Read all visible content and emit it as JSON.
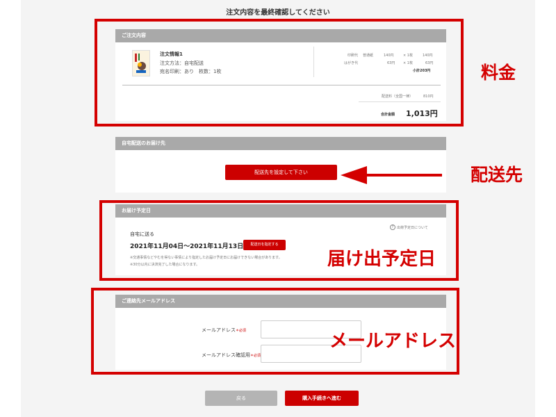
{
  "page_title": "注文内容を最終確認してください",
  "order_panel": {
    "header": "ご注文内容",
    "product_name": "注文情報1",
    "shipping_method": "注文方法：自宅配送",
    "print_option": "宛名印刷：あり　枚数：1枚",
    "price_rows": [
      {
        "label": "印刷代",
        "item": "普通紙",
        "unit": "140円",
        "qty": "× 1枚",
        "amount": "140円"
      },
      {
        "label": "はがき代",
        "item": "",
        "unit": "63円",
        "qty": "× 1枚",
        "amount": "63円"
      }
    ],
    "subtotal": "小計203円",
    "shipping_fee_label": "配送料（全国一律）",
    "shipping_fee_value": "810円",
    "total_label": "合計金額",
    "total_value": "1,013円"
  },
  "delivery_dest_panel": {
    "header": "自宅配送のお届け先",
    "set_button": "配送先を設定して下さい"
  },
  "delivery_date_panel": {
    "header": "お届け予定日",
    "help_link": "出荷予定日について",
    "help_icon": "?",
    "method": "自宅に送る",
    "date_range": "2021年11月04日〜2021年11月13日",
    "specify_button": "配送日を指定する",
    "note1": "※交通事情などやむを得ない事情により指定したお届け予定日にお届けできない場合があります。",
    "note2": "※30分以内に決済完了した場合になります。"
  },
  "email_panel": {
    "header": "ご連絡先メールアドレス",
    "email_label": "メールアドレス",
    "confirm_label": "メールアドレス確認用",
    "required": "＊必須"
  },
  "buttons": {
    "back": "戻る",
    "proceed": "購入手続きへ進む"
  },
  "annotations": {
    "price": "料金",
    "destination": "配送先",
    "delivery_date": "届け出予定日",
    "email": "メールアドレス"
  },
  "colors": {
    "accent_red": "#cc0000",
    "annotation_red": "#d40000",
    "header_gray": "#a9a9a9"
  }
}
